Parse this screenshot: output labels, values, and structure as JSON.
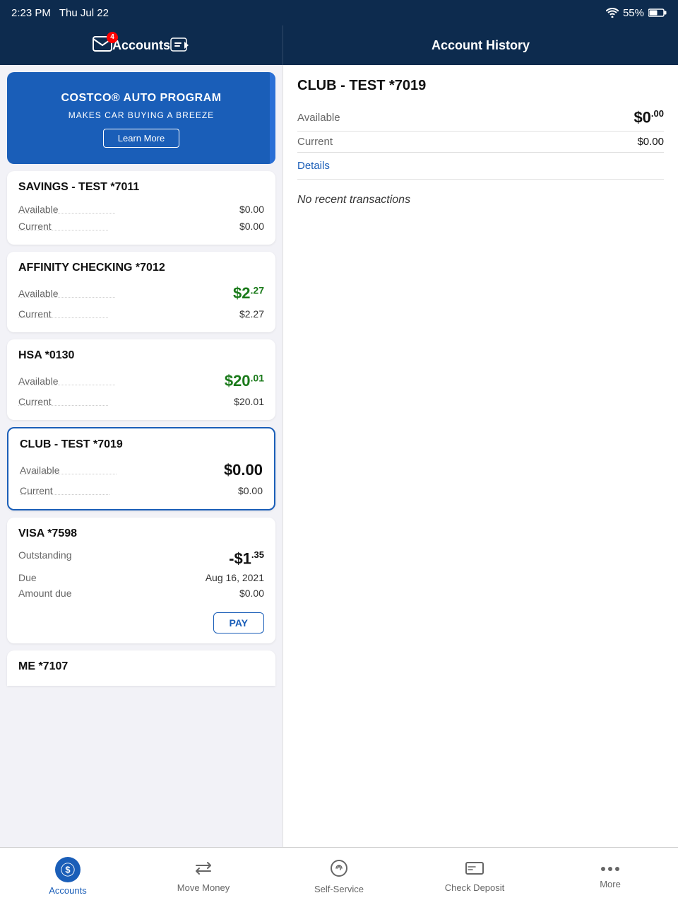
{
  "statusBar": {
    "time": "2:23 PM",
    "day": "Thu Jul 22",
    "battery": "55%",
    "wifi": true
  },
  "header": {
    "leftTitle": "Accounts",
    "rightTitle": "Account History",
    "mailBadge": "4"
  },
  "banner": {
    "title": "COSTCO® AUTO PROGRAM",
    "subtitle": "MAKES CAR BUYING A BREEZE",
    "buttonLabel": "Learn More"
  },
  "accounts": [
    {
      "id": "savings",
      "name": "SAVINGS - TEST *7011",
      "type": "savings",
      "available": "$0.00",
      "availableHighlight": false,
      "current": "$0.00",
      "selected": false
    },
    {
      "id": "affinity",
      "name": "AFFINITY CHECKING *7012",
      "type": "checking",
      "available": "$2.27",
      "availableHighlight": true,
      "availableFormatted": {
        "dollars": "$2",
        "cents": ".27"
      },
      "current": "$2.27",
      "selected": false
    },
    {
      "id": "hsa",
      "name": "HSA *0130",
      "type": "hsa",
      "available": "$20.01",
      "availableHighlight": true,
      "availableFormatted": {
        "dollars": "$20",
        "cents": ".01"
      },
      "current": "$20.01",
      "selected": false
    },
    {
      "id": "club",
      "name": "CLUB - TEST *7019",
      "type": "club",
      "available": "$0.00",
      "availableHighlight": false,
      "current": "$0.00",
      "selected": true
    },
    {
      "id": "visa",
      "name": "VISA *7598",
      "type": "visa",
      "outstanding": "-$1.35",
      "outstandingFormatted": {
        "dollars": "-$1",
        "cents": ".35"
      },
      "due": "Aug 16, 2021",
      "amountDue": "$0.00",
      "selected": false
    },
    {
      "id": "me",
      "name": "ME *7107",
      "type": "other",
      "selected": false
    }
  ],
  "history": {
    "accountName": "CLUB - TEST *7019",
    "available": "$0.00",
    "availableFormatted": {
      "dollars": "$0",
      "cents": ".00"
    },
    "current": "$0.00",
    "detailsLabel": "Details",
    "noTransactions": "No recent transactions"
  },
  "nav": {
    "items": [
      {
        "id": "accounts",
        "label": "Accounts",
        "active": true
      },
      {
        "id": "move-money",
        "label": "Move Money",
        "active": false
      },
      {
        "id": "self-service",
        "label": "Self-Service",
        "active": false
      },
      {
        "id": "check-deposit",
        "label": "Check Deposit",
        "active": false
      },
      {
        "id": "more",
        "label": "More",
        "active": false
      }
    ]
  }
}
